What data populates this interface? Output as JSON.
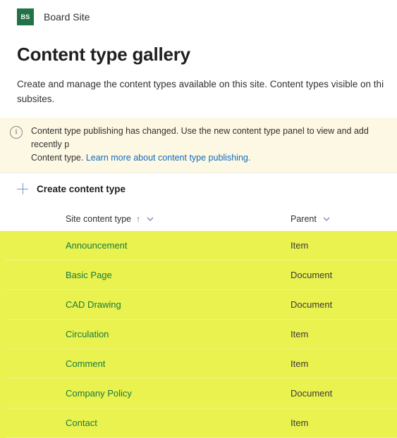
{
  "site": {
    "logo_initials": "BS",
    "logo_color": "#217346",
    "name": "Board Site"
  },
  "page": {
    "title": "Content type gallery",
    "description": "Create and manage the content types available on this site. Content types visible on thi\nsubsites."
  },
  "banner": {
    "icon": "info-circle-icon",
    "icon_glyph": "i",
    "text_before_link": "Content type publishing has changed. Use the new content type panel to view and add recently p\nContent type. ",
    "link_text": "Learn more about content type publishing.",
    "link_color": "#0f6cbd",
    "background": "#fdf8e4"
  },
  "command_bar": {
    "create_icon": "plus-icon",
    "create_label": "Create content type"
  },
  "table": {
    "highlight_color": "#e9f24e",
    "link_color": "#177a3f",
    "columns": [
      {
        "label": "Site content type",
        "sort": "↑",
        "chevron": "chevron-down-icon"
      },
      {
        "label": "Parent",
        "sort": "",
        "chevron": "chevron-down-icon"
      }
    ],
    "rows": [
      {
        "name": "Announcement",
        "parent": "Item"
      },
      {
        "name": "Basic Page",
        "parent": "Document"
      },
      {
        "name": "CAD Drawing",
        "parent": "Document"
      },
      {
        "name": "Circulation",
        "parent": "Item"
      },
      {
        "name": "Comment",
        "parent": "Item"
      },
      {
        "name": "Company Policy",
        "parent": "Document"
      },
      {
        "name": "Contact",
        "parent": "Item"
      }
    ]
  }
}
